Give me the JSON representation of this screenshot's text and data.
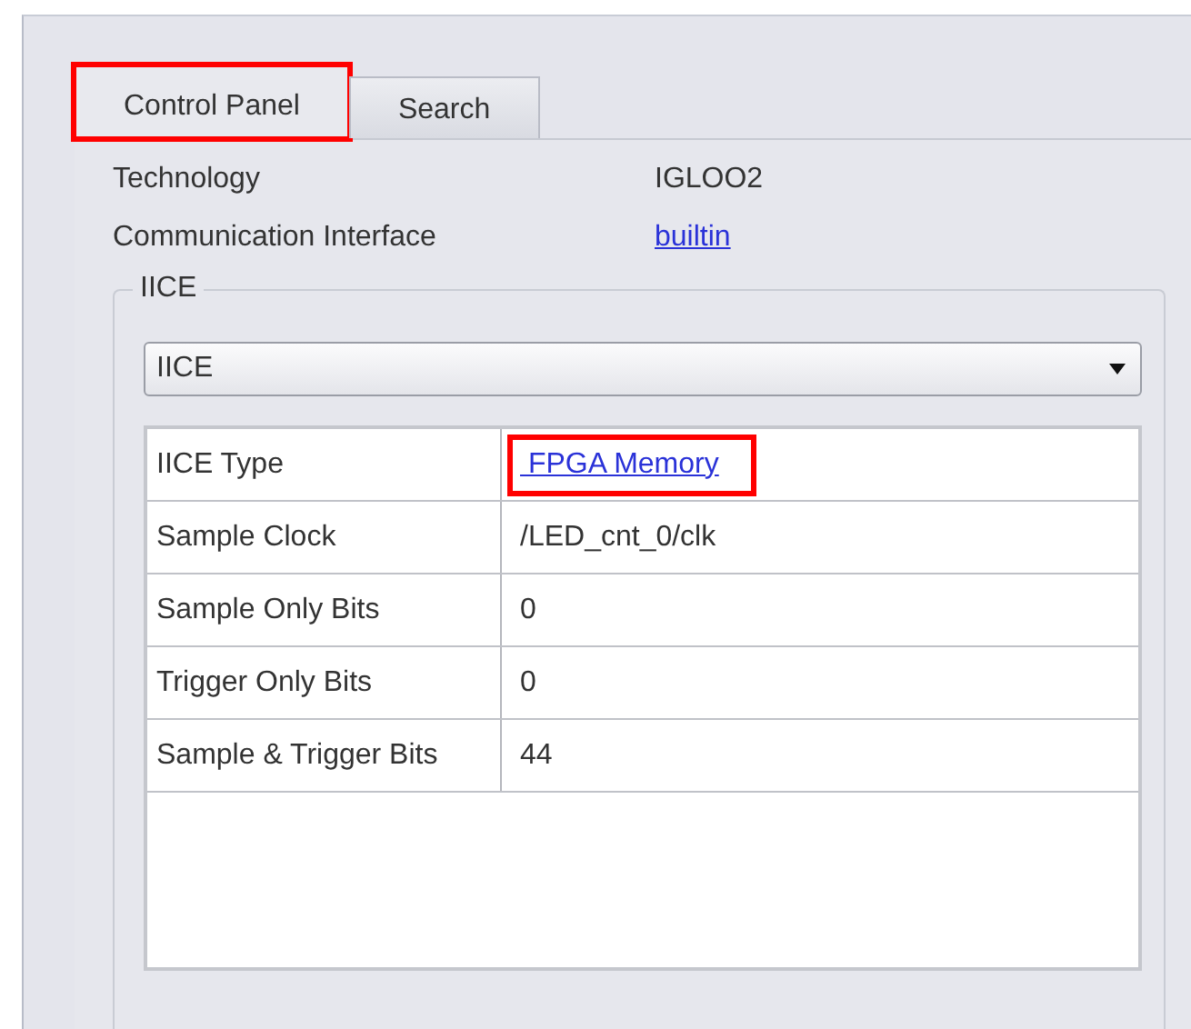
{
  "tabs": [
    {
      "label": "Control Panel",
      "selected": true,
      "highlighted": true
    },
    {
      "label": "Search",
      "selected": false,
      "highlighted": false
    }
  ],
  "info": [
    {
      "label": "Technology",
      "value": "IGLOO2",
      "kind": "text"
    },
    {
      "label": "Communication Interface",
      "value": "builtin",
      "kind": "link"
    }
  ],
  "group": {
    "title": "IICE",
    "dropdown": {
      "value": "IICE"
    },
    "table": {
      "rows": [
        {
          "label": "IICE Type",
          "value": " FPGA Memory",
          "kind": "link",
          "highlighted": true
        },
        {
          "label": "Sample Clock",
          "value": "/LED_cnt_0/clk",
          "kind": "text",
          "highlighted": false
        },
        {
          "label": "Sample Only Bits",
          "value": "0",
          "kind": "text",
          "highlighted": false
        },
        {
          "label": "Trigger Only Bits",
          "value": "0",
          "kind": "text",
          "highlighted": false
        },
        {
          "label": "Sample & Trigger Bits",
          "value": "44",
          "kind": "text",
          "highlighted": false
        }
      ]
    }
  }
}
